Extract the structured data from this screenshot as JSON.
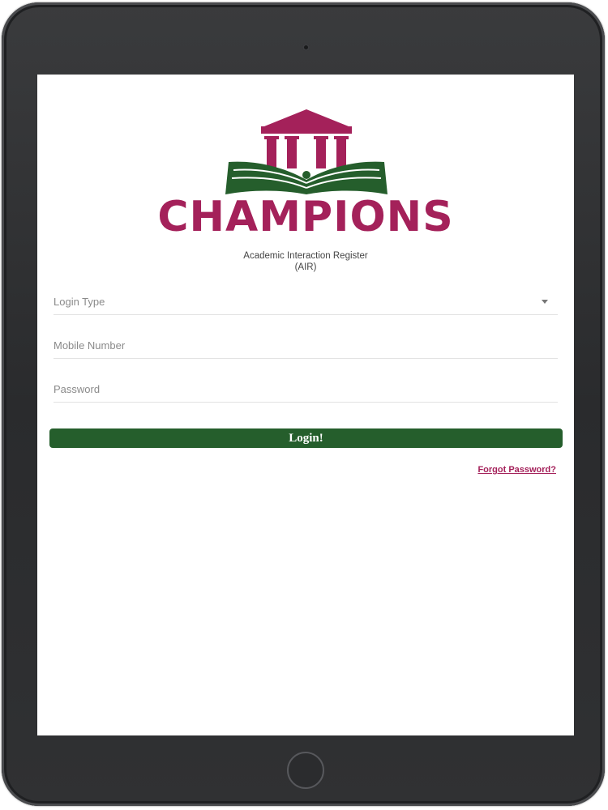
{
  "app": {
    "brand_name": "CHAMPIONS",
    "subtitle_line1": "Academic Interaction Register",
    "subtitle_line2": "(AIR)"
  },
  "form": {
    "login_type": {
      "label": "Login Type",
      "selected": ""
    },
    "mobile": {
      "placeholder": "Mobile Number",
      "value": ""
    },
    "password": {
      "placeholder": "Password",
      "value": ""
    },
    "login_button": "Login!",
    "forgot_link": "Forgot Password?"
  },
  "colors": {
    "brand_magenta": "#a4215a",
    "brand_green": "#255e2c",
    "device_frame": "#2f3032"
  },
  "icons": {
    "logo": "pillared-building-open-book-icon",
    "dropdown": "caret-down-icon",
    "camera": "front-camera-icon",
    "home": "home-button"
  }
}
